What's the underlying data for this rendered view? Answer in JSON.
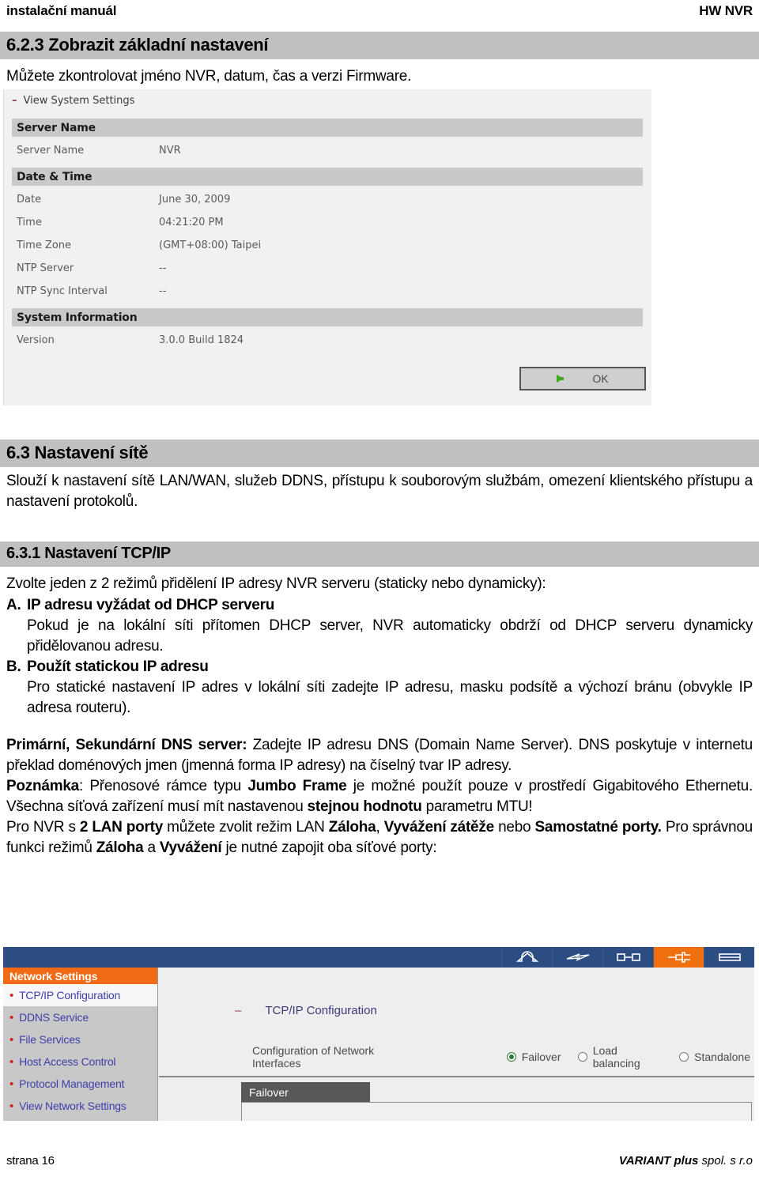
{
  "header": {
    "left": "instalační manuál",
    "right": "HW NVR"
  },
  "sections": {
    "s623": {
      "heading": "6.2.3 Zobrazit základní nastavení",
      "intro": "Můžete zkontrolovat jméno NVR, datum, čas a verzi Firmware."
    },
    "s63": {
      "heading": "6.3  Nastavení sítě",
      "intro": "Slouží k nastavení sítě LAN/WAN, služeb DDNS, přístupu k souborovým službám, omezení klientského přístupu a nastavení protokolů."
    },
    "s631": {
      "heading": "6.3.1 Nastavení TCP/IP",
      "intro": "Zvolte jeden z 2 režimů přidělení IP adresy NVR serveru (staticky nebo dynamicky):",
      "options": [
        {
          "marker": "A.",
          "title": "IP adresu vyžádat od DHCP serveru",
          "desc": "Pokud je na lokální síti přítomen DHCP server, NVR automaticky obdrží od DHCP serveru dynamicky přidělovanou adresu."
        },
        {
          "marker": "B.",
          "title": "Použít statickou IP adresu",
          "desc": "Pro statické nastavení IP adres v lokální síti zadejte IP adresu, masku podsítě a výchozí bránu (obvykle IP adresa routeru)."
        }
      ],
      "para_dns_b1": "Primární, Sekundární DNS server:",
      "para_dns_t1": " Zadejte IP adresu DNS (Domain Name Server). DNS poskytuje v internetu překlad doménových jmen (jmenná forma IP adresy) na číselný tvar IP adresy.",
      "para_note_b1": "Poznámka",
      "para_note_t1": ": Přenosové rámce typu ",
      "para_note_b2": "Jumbo Frame",
      "para_note_t2": " je možné použít pouze v prostředí Gigabitového Ethernetu. Všechna síťová zařízení musí mít nastavenou ",
      "para_note_b3": "stejnou hodnotu",
      "para_note_t3": " parametru MTU!",
      "para_lan_t1": "Pro NVR s ",
      "para_lan_b1": "2 LAN porty",
      "para_lan_t2": " můžete zvolit režim LAN ",
      "para_lan_b2": "Záloha",
      "para_lan_t3": ", ",
      "para_lan_b3": "Vyvážení zátěže",
      "para_lan_t4": " nebo ",
      "para_lan_b4": "Samostatné porty.",
      "para_lan_t5": " Pro správnou funkci režimů ",
      "para_lan_b5": "Záloha",
      "para_lan_t6": " a ",
      "para_lan_b6": "Vyvážení",
      "para_lan_t7": " je nutné zapojit oba síťové porty:"
    }
  },
  "screenshot_system_settings": {
    "panel_title": "View System Settings",
    "collapse_glyph": "–",
    "group_server_name": "Server Name",
    "group_date_time": "Date & Time",
    "group_system_information": "System Information",
    "rows": [
      {
        "key": "Server Name",
        "value": "NVR"
      },
      {
        "key": "Date",
        "value": "June 30, 2009"
      },
      {
        "key": "Time",
        "value": "04:21:20 PM"
      },
      {
        "key": "Time Zone",
        "value": "(GMT+08:00) Taipei"
      },
      {
        "key": "NTP Server",
        "value": "--"
      },
      {
        "key": "NTP Sync Interval",
        "value": "--"
      },
      {
        "key": "Version",
        "value": "3.0.0 Build 1824"
      }
    ],
    "ok_button": "OK"
  },
  "screenshot_network_settings": {
    "toolbar_icons": [
      {
        "name": "home-icon",
        "active": false
      },
      {
        "name": "power-bolt-icon",
        "active": false
      },
      {
        "name": "storage-disk-icon",
        "active": false
      },
      {
        "name": "network-icon",
        "active": true
      },
      {
        "name": "list-view-icon",
        "active": false
      }
    ],
    "sidebar_heading": "Network Settings",
    "sidebar_items": [
      {
        "label": "TCP/IP Configuration",
        "selected": true
      },
      {
        "label": "DDNS Service",
        "selected": false
      },
      {
        "label": "File Services",
        "selected": false
      },
      {
        "label": "Host Access Control",
        "selected": false
      },
      {
        "label": "Protocol Management",
        "selected": false
      },
      {
        "label": "View Network Settings",
        "selected": false
      }
    ],
    "content_title": "TCP/IP Configuration",
    "content_collapse_glyph": "–",
    "interfaces_label": "Configuration of Network Interfaces",
    "radio_options": [
      {
        "label": "Failover",
        "checked": true
      },
      {
        "label": "Load balancing",
        "checked": false
      },
      {
        "label": "Standalone",
        "checked": false
      }
    ],
    "active_tab": "Failover",
    "colors": {
      "navbar": "#2b4d82",
      "accent_orange": "#f26a16",
      "sidebar_link": "#3e3ea8",
      "bullet_red": "#d02020",
      "radio_green": "#2f7d32"
    }
  },
  "footer": {
    "left": "strana 16",
    "right_bold": "VARIANT plus",
    "right_italic": " spol. s r.o"
  }
}
